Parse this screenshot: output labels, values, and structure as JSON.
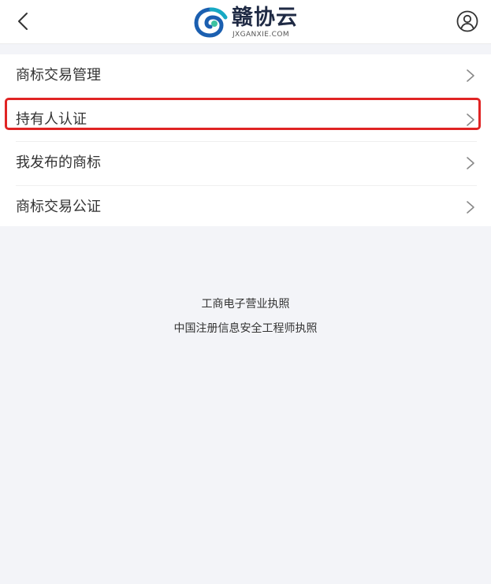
{
  "header": {
    "back_icon": "chevron-left-icon",
    "logo_name": "赣协云",
    "logo_domain": "JXGANXIE.COM",
    "user_icon": "user-circle-icon",
    "logo_colors": {
      "teal": "#17a9c4",
      "blue": "#1b5fb0",
      "green": "#3cc2a0"
    }
  },
  "menu": {
    "items": [
      {
        "label": "商标交易管理",
        "icon": "chevron-right-icon"
      },
      {
        "label": "持有人认证",
        "icon": "chevron-right-icon",
        "highlighted": true
      },
      {
        "label": "我发布的商标",
        "icon": "chevron-right-icon"
      },
      {
        "label": "商标交易公证",
        "icon": "chevron-right-icon"
      }
    ],
    "highlight_color": "#e02424"
  },
  "footer": {
    "line1": "工商电子营业执照",
    "line2": "中国注册信息安全工程师执照"
  }
}
